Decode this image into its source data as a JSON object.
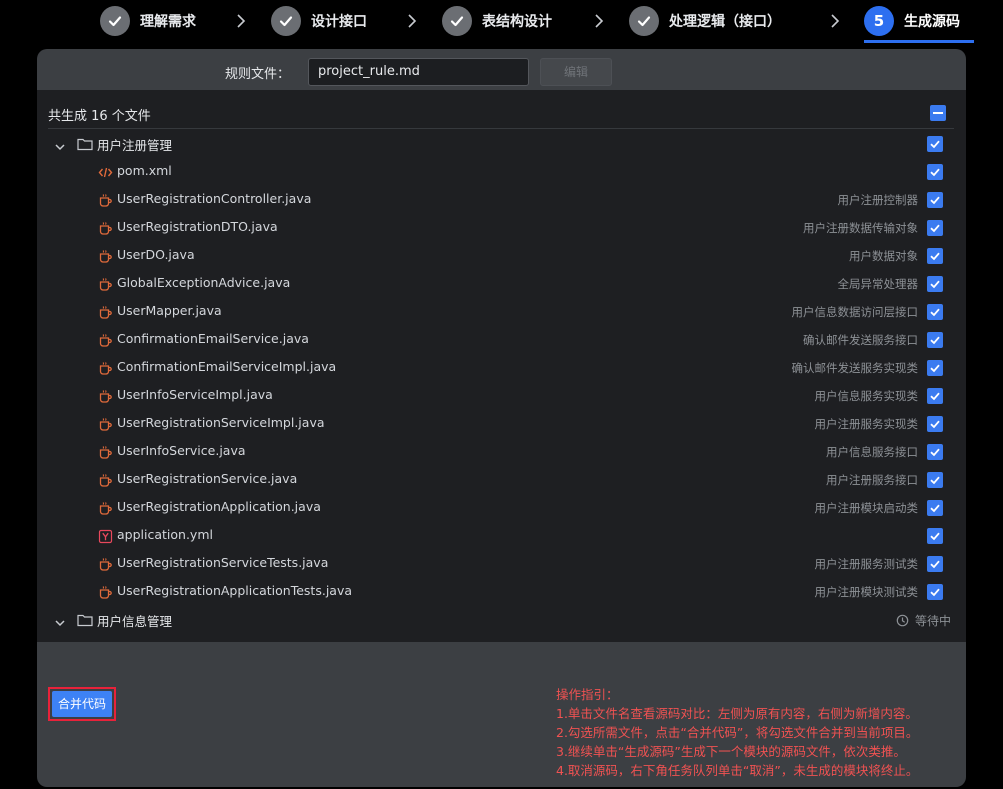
{
  "stepper": {
    "steps": [
      {
        "label": "理解需求",
        "state": "done"
      },
      {
        "label": "设计接口",
        "state": "done"
      },
      {
        "label": "表结构设计",
        "state": "done"
      },
      {
        "label": "处理逻辑（接口）",
        "state": "done"
      },
      {
        "label": "生成源码",
        "number": "5",
        "state": "active"
      }
    ]
  },
  "rule": {
    "label": "规则文件：",
    "value": "project_rule.md",
    "edit_label": "编辑"
  },
  "files": {
    "summary": "共生成 16 个文件",
    "groups": [
      {
        "name": "用户注册管理",
        "expanded": true,
        "checked": true,
        "items": [
          {
            "name": "pom.xml",
            "desc": "",
            "icon": "xml-icon"
          },
          {
            "name": "UserRegistrationController.java",
            "desc": "用户注册控制器",
            "icon": "java-icon"
          },
          {
            "name": "UserRegistrationDTO.java",
            "desc": "用户注册数据传输对象",
            "icon": "java-icon"
          },
          {
            "name": "UserDO.java",
            "desc": "用户数据对象",
            "icon": "java-icon"
          },
          {
            "name": "GlobalExceptionAdvice.java",
            "desc": "全局异常处理器",
            "icon": "java-icon"
          },
          {
            "name": "UserMapper.java",
            "desc": "用户信息数据访问层接口",
            "icon": "java-icon"
          },
          {
            "name": "ConfirmationEmailService.java",
            "desc": "确认邮件发送服务接口",
            "icon": "java-icon"
          },
          {
            "name": "ConfirmationEmailServiceImpl.java",
            "desc": "确认邮件发送服务实现类",
            "icon": "java-icon"
          },
          {
            "name": "UserInfoServiceImpl.java",
            "desc": "用户信息服务实现类",
            "icon": "java-icon"
          },
          {
            "name": "UserRegistrationServiceImpl.java",
            "desc": "用户注册服务实现类",
            "icon": "java-icon"
          },
          {
            "name": "UserInfoService.java",
            "desc": "用户信息服务接口",
            "icon": "java-icon"
          },
          {
            "name": "UserRegistrationService.java",
            "desc": "用户注册服务接口",
            "icon": "java-icon"
          },
          {
            "name": "UserRegistrationApplication.java",
            "desc": "用户注册模块启动类",
            "icon": "java-icon"
          },
          {
            "name": "application.yml",
            "desc": "",
            "icon": "yml-icon"
          },
          {
            "name": "UserRegistrationServiceTests.java",
            "desc": "用户注册服务测试类",
            "icon": "java-icon"
          },
          {
            "name": "UserRegistrationApplicationTests.java",
            "desc": "用户注册模块测试类",
            "icon": "java-icon"
          }
        ]
      },
      {
        "name": "用户信息管理",
        "status": "等待中",
        "status_icon": "history-icon"
      }
    ]
  },
  "actions": {
    "merge_label": "合并代码"
  },
  "guide": {
    "lines": [
      "操作指引：",
      "1.单击文件名查看源码对比：左侧为原有内容，右侧为新增内容。",
      "2.勾选所需文件，点击“合并代码”，将勾选文件合并到当前项目。",
      "3.继续单击“生成源码”生成下一个模块的源码文件，依次类推。",
      "4.取消源码，右下角任务队列单击“取消”，未生成的模块将终止。"
    ]
  },
  "colors": {
    "accent": "#2d6ff0",
    "checkbox": "#3b7bf0",
    "merge": "#3d82f5",
    "guide": "#f05252",
    "highlight": "#e8223a",
    "java": "#e06a3b",
    "xml": "#e06a3b",
    "yml": "#e8485c"
  }
}
